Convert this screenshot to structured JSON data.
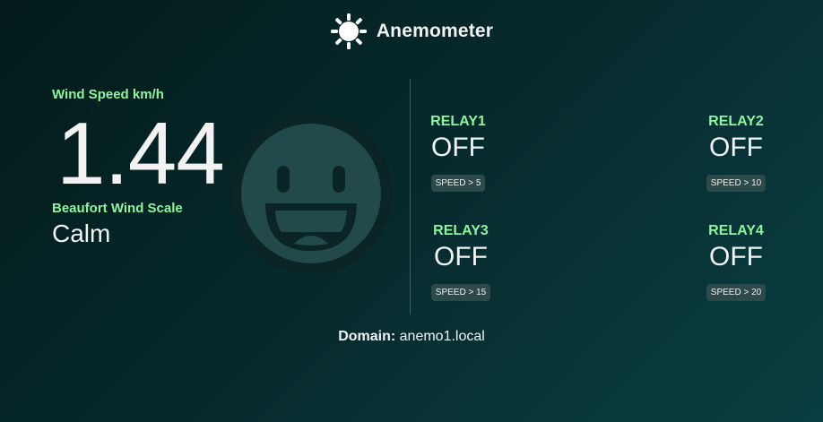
{
  "header": {
    "title": "Anemometer",
    "logo_icon": "sun-icon"
  },
  "wind": {
    "speed_label": "Wind Speed km/h",
    "speed_value": "1.44",
    "beaufort_label": "Beaufort Wind Scale",
    "beaufort_value": "Calm",
    "face_icon": "happy-face-icon"
  },
  "relays": [
    {
      "name": "RELAY1",
      "state": "OFF",
      "threshold": "SPEED > 5"
    },
    {
      "name": "RELAY2",
      "state": "OFF",
      "threshold": "SPEED > 10"
    },
    {
      "name": "RELAY3",
      "state": "OFF",
      "threshold": "SPEED > 15"
    },
    {
      "name": "RELAY4",
      "state": "OFF",
      "threshold": "SPEED > 20"
    }
  ],
  "footer": {
    "domain_label": "Domain:",
    "domain_value": "anemo1.local"
  },
  "colors": {
    "accent_green": "#8cf59d",
    "background_dark": "#021a1a",
    "background_teal": "#0a3e42",
    "badge_bg": "#2d4a4a"
  }
}
